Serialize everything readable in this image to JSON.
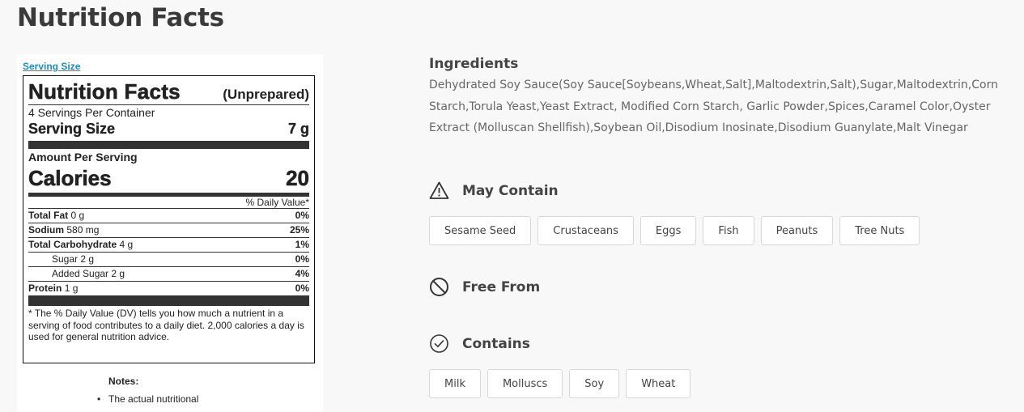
{
  "page": {
    "title": "Nutrition Facts"
  },
  "label": {
    "serving_size_link": "Serving Size",
    "title": "Nutrition Facts",
    "subtitle": "(Unprepared)",
    "servings_per_container": "4 Servings Per Container",
    "serving_size_label": "Serving Size",
    "serving_size_value": "7 g",
    "amount_per_serving": "Amount Per Serving",
    "calories_label": "Calories",
    "calories_value": "20",
    "daily_value_header": "% Daily Value*",
    "nutrients": [
      {
        "name": "Total Fat",
        "amount": "0 g",
        "dv": "0%",
        "indent": false
      },
      {
        "name": "Sodium",
        "amount": "580 mg",
        "dv": "25%",
        "indent": false
      },
      {
        "name": "Total Carbohydrate",
        "amount": "4 g",
        "dv": "1%",
        "indent": false
      },
      {
        "name": "Sugar",
        "amount": "2 g",
        "dv": "0%",
        "indent": true
      },
      {
        "name": "Added Sugar",
        "amount": "2 g",
        "dv": "4%",
        "indent": true
      },
      {
        "name": "Protein",
        "amount": "1 g",
        "dv": "0%",
        "indent": false
      }
    ],
    "footnote": "* The % Daily Value (DV) tells you how much a nutrient in a serving of food contributes to a daily diet. 2,000 calories a day is used for general nutrition advice."
  },
  "notes": {
    "title": "Notes:",
    "items": [
      "The actual nutritional"
    ]
  },
  "ingredients": {
    "title": "Ingredients",
    "text": "Dehydrated Soy Sauce(Soy Sauce[Soybeans,Wheat,Salt],Maltodextrin,Salt),Sugar,Maltodextrin,Corn Starch,Torula Yeast,Yeast Extract, Modified Corn Starch, Garlic Powder,Spices,Caramel Color,Oyster Extract (Molluscan Shellfish),Soybean Oil,Disodium Inosinate,Disodium Guanylate,Malt Vinegar"
  },
  "may_contain": {
    "title": "May Contain",
    "icon": "warning-triangle-icon",
    "items": [
      "Sesame Seed",
      "Crustaceans",
      "Eggs",
      "Fish",
      "Peanuts",
      "Tree Nuts"
    ]
  },
  "free_from": {
    "title": "Free From",
    "icon": "prohibited-icon",
    "items": []
  },
  "contains": {
    "title": "Contains",
    "icon": "check-circle-icon",
    "items": [
      "Milk",
      "Molluscs",
      "Soy",
      "Wheat"
    ]
  },
  "colors": {
    "link": "#1a8ac8",
    "background": "#f8f8f8",
    "heading": "#3a3a3a"
  }
}
